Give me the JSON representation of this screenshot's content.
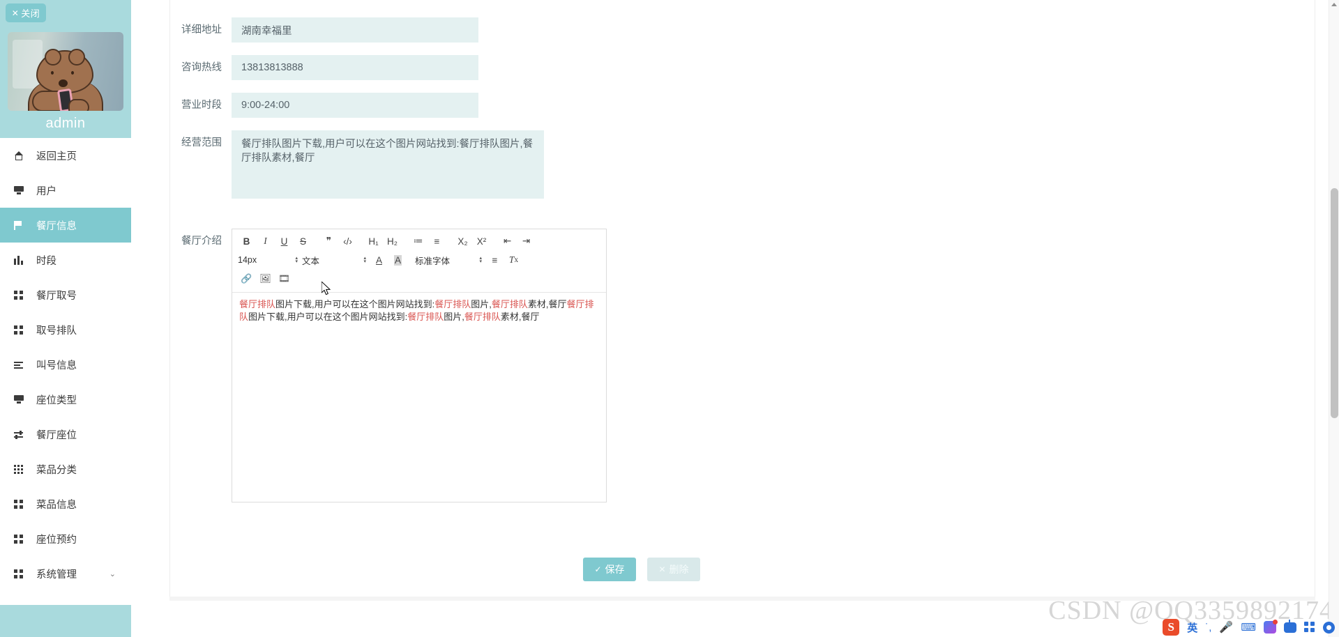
{
  "sidebar": {
    "close_label": "关闭",
    "close_icon": "close-x-icon",
    "username": "admin",
    "avatar_alt": "bear-avatar",
    "items": [
      {
        "label": "返回主页",
        "icon": "home-icon",
        "active": false,
        "chevron": ""
      },
      {
        "label": "用户",
        "icon": "monitor-icon",
        "active": false,
        "chevron": ""
      },
      {
        "label": "餐厅信息",
        "icon": "flag-icon",
        "active": true,
        "chevron": ""
      },
      {
        "label": "时段",
        "icon": "bars-icon",
        "active": false,
        "chevron": ""
      },
      {
        "label": "餐厅取号",
        "icon": "grid4-icon",
        "active": false,
        "chevron": ""
      },
      {
        "label": "取号排队",
        "icon": "grid4-icon",
        "active": false,
        "chevron": ""
      },
      {
        "label": "叫号信息",
        "icon": "list-icon",
        "active": false,
        "chevron": ""
      },
      {
        "label": "座位类型",
        "icon": "monitor-icon",
        "active": false,
        "chevron": ""
      },
      {
        "label": "餐厅座位",
        "icon": "slider-icon",
        "active": false,
        "chevron": ""
      },
      {
        "label": "菜品分类",
        "icon": "grid9-icon",
        "active": false,
        "chevron": ""
      },
      {
        "label": "菜品信息",
        "icon": "grid4-icon",
        "active": false,
        "chevron": ""
      },
      {
        "label": "座位预约",
        "icon": "grid4-icon",
        "active": false,
        "chevron": ""
      },
      {
        "label": "系统管理",
        "icon": "grid4-icon",
        "active": false,
        "chevron": "⌄"
      }
    ]
  },
  "form": {
    "fields": [
      {
        "label": "详细地址",
        "value": "湖南幸福里",
        "type": "text"
      },
      {
        "label": "咨询热线",
        "value": "13813813888",
        "type": "text"
      },
      {
        "label": "营业时段",
        "value": "9:00-24:00",
        "type": "text"
      },
      {
        "label": "经营范围",
        "value": "餐厅排队图片下载,用户可以在这个图片网站找到:餐厅排队图片,餐厅排队素材,餐厅",
        "type": "textarea"
      }
    ],
    "editor_label": "餐厅介绍"
  },
  "editor": {
    "toolbar_row1": [
      {
        "name": "bold-icon",
        "glyph": "B",
        "style": "bold"
      },
      {
        "name": "italic-icon",
        "glyph": "I",
        "style": "ital"
      },
      {
        "name": "underline-icon",
        "glyph": "U",
        "style": "under"
      },
      {
        "name": "strikethrough-icon",
        "glyph": "S",
        "style": "strike"
      },
      {
        "name": "blockquote-icon",
        "glyph": "❞",
        "style": ""
      },
      {
        "name": "code-block-icon",
        "glyph": "‹/›",
        "style": ""
      },
      {
        "name": "heading1-icon",
        "glyph": "H₁",
        "style": ""
      },
      {
        "name": "heading2-icon",
        "glyph": "H₂",
        "style": ""
      },
      {
        "name": "ordered-list-icon",
        "glyph": "≔",
        "style": ""
      },
      {
        "name": "bullet-list-icon",
        "glyph": "≡",
        "style": ""
      },
      {
        "name": "subscript-icon",
        "glyph": "X₂",
        "style": ""
      },
      {
        "name": "superscript-icon",
        "glyph": "X²",
        "style": ""
      },
      {
        "name": "outdent-icon",
        "glyph": "⇤",
        "style": ""
      },
      {
        "name": "indent-icon",
        "glyph": "⇥",
        "style": ""
      }
    ],
    "font_size": "14px",
    "text_style": "文本",
    "font_family": "标准字体",
    "toolbar_row2_icons": [
      {
        "name": "font-color-icon",
        "glyph": "A"
      },
      {
        "name": "background-color-icon",
        "glyph": "A"
      },
      {
        "name": "align-icon",
        "glyph": "≡"
      },
      {
        "name": "clear-format-icon",
        "glyph": "Tx"
      }
    ],
    "toolbar_row3": [
      {
        "name": "link-icon",
        "glyph": "🔗"
      },
      {
        "name": "image-icon",
        "glyph": "🖼"
      },
      {
        "name": "video-icon",
        "glyph": "🎞"
      }
    ],
    "content_segments": [
      {
        "text": "餐厅排队",
        "highlight": true
      },
      {
        "text": "图片下载,用户可以在这个图片网站找到:",
        "highlight": false
      },
      {
        "text": "餐厅排队",
        "highlight": true
      },
      {
        "text": "图片,",
        "highlight": false
      },
      {
        "text": "餐厅排队",
        "highlight": true
      },
      {
        "text": "素材,餐厅",
        "highlight": false
      },
      {
        "text": "餐厅排队",
        "highlight": true
      },
      {
        "text": "图片下载,用户可以在这个图片网站找到:",
        "highlight": false
      },
      {
        "text": "餐厅排队",
        "highlight": true
      },
      {
        "text": "图片,",
        "highlight": false
      },
      {
        "text": "餐厅排队",
        "highlight": true
      },
      {
        "text": "素材,餐厅",
        "highlight": false
      }
    ]
  },
  "actions": {
    "save_label": "保存",
    "save_icon": "check-icon",
    "delete_label": "删除",
    "delete_icon": "close-x-icon"
  },
  "watermark": {
    "text": "CSDN @QQ3359892174"
  },
  "ime": {
    "logo": "S",
    "mode_label": "英",
    "items": [
      {
        "name": "sogou-logo-icon"
      },
      {
        "name": "ime-mode-chinese-icon"
      },
      {
        "name": "ime-punctuation-icon"
      },
      {
        "name": "ime-voice-input-icon"
      },
      {
        "name": "ime-keyboard-icon"
      },
      {
        "name": "ime-flow-icon"
      },
      {
        "name": "ime-robot-icon"
      },
      {
        "name": "ime-app-grid-icon"
      },
      {
        "name": "ime-settings-icon"
      }
    ]
  },
  "colors": {
    "sidebar_bg": "#a9dadd",
    "accent": "#7fc9cf",
    "input_bg": "#e4f1f1",
    "highlight_red": "#d9534f"
  }
}
